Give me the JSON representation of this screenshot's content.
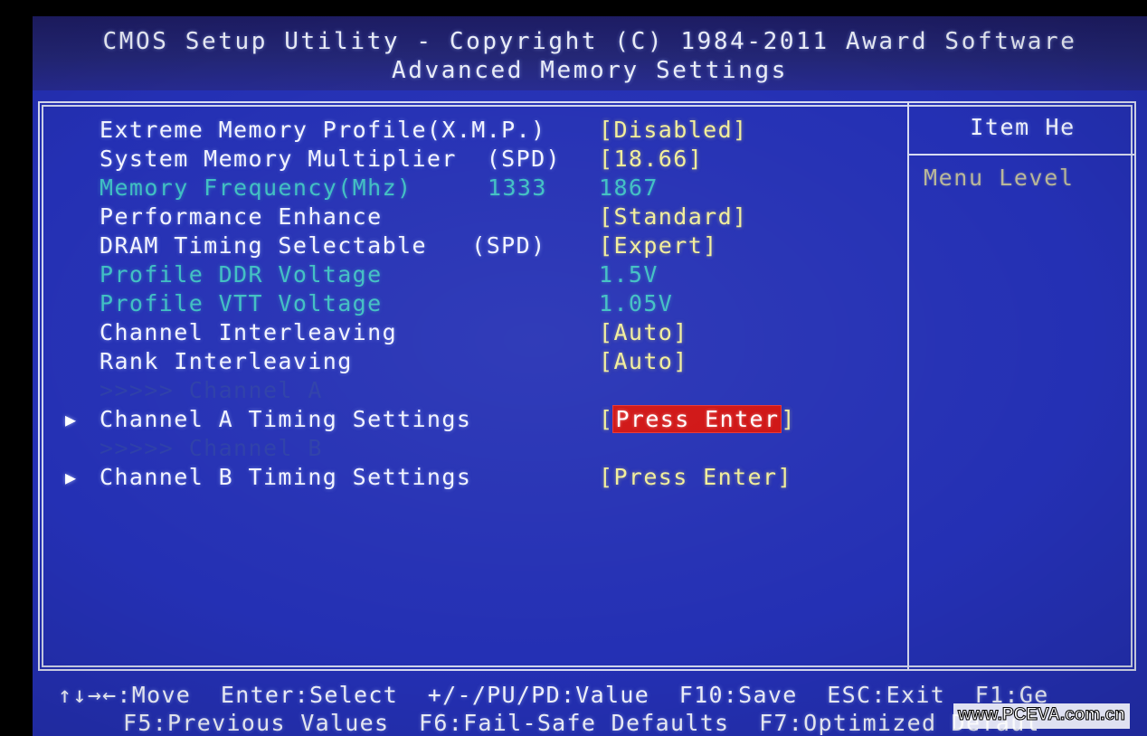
{
  "header": {
    "title": "CMOS Setup Utility - Copyright (C) 1984-2011 Award Software",
    "subtitle": "Advanced Memory Settings"
  },
  "settings": {
    "rows": [
      {
        "label": "Extreme Memory Profile(X.M.P.)",
        "value": "[Disabled]"
      },
      {
        "label": "System Memory Multiplier  (SPD)",
        "value": "[18.66]"
      },
      {
        "label": "Memory Frequency(Mhz)",
        "value_a": "1333",
        "value_b": "1867"
      },
      {
        "label": "Performance Enhance",
        "value": "[Standard]"
      },
      {
        "label": "DRAM Timing Selectable   (SPD)",
        "value": "[Expert]"
      },
      {
        "label": "Profile DDR Voltage",
        "value": "1.5V"
      },
      {
        "label": "Profile VTT Voltage",
        "value": "1.05V"
      },
      {
        "label": "Channel Interleaving",
        "value": "[Auto]"
      },
      {
        "label": "Rank Interleaving",
        "value": "[Auto]"
      },
      {
        "label": ">>>>> Channel A",
        "value": ""
      },
      {
        "label": "Channel A Timing Settings",
        "bracket_open": "[",
        "value_hl": "Press Enter",
        "bracket_close": "]",
        "arrow": "▶"
      },
      {
        "label": ">>>>> Channel B",
        "value": ""
      },
      {
        "label": "Channel B Timing Settings",
        "value": "[Press Enter]",
        "arrow": "▶"
      }
    ]
  },
  "item_help": {
    "title": "Item He",
    "menu_level": "Menu Level"
  },
  "footer": {
    "line1": "↑↓→←:Move  Enter:Select  +/-/PU/PD:Value  F10:Save  ESC:Exit  F1:Ge",
    "line2": "F5:Previous Values  F6:Fail-Safe Defaults  F7:Optimized Defaul"
  },
  "watermark": {
    "text": "www.PCEVA.com.cn"
  },
  "colors": {
    "screen_bg": "#2430b4",
    "header_bg": "#232675",
    "text_white": "#f2f4ff",
    "text_yellow": "#f2ee9a",
    "text_teal": "#3fbfc2",
    "text_dim": "#2c3ea8",
    "text_gray": "#b9b79a",
    "highlight_bg": "#cf1111",
    "border": "#d8dcf2"
  }
}
